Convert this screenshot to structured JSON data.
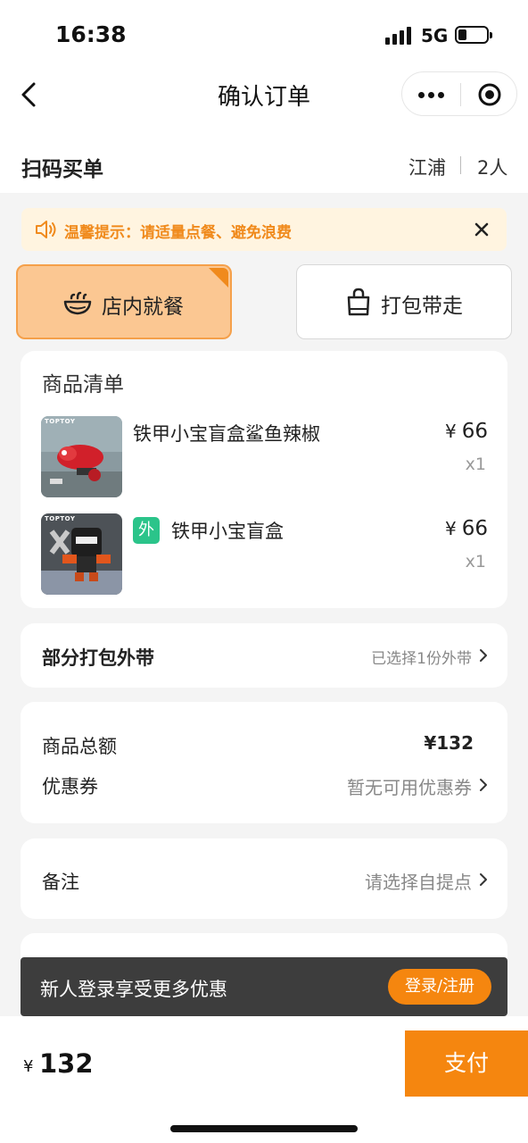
{
  "status_bar": {
    "time": "16:38",
    "network": "5G",
    "battery_level": 0.3
  },
  "nav": {
    "title": "确认订单"
  },
  "header": {
    "subtitle": "扫码买单",
    "store": "江浦",
    "people": "2人"
  },
  "notice": {
    "text": "温馨提示：请适量点餐、避免浪费"
  },
  "dining_modes": [
    {
      "label": "店内就餐",
      "selected": true,
      "icon": "bowl-icon"
    },
    {
      "label": "打包带走",
      "selected": false,
      "icon": "bag-icon"
    }
  ],
  "goods": {
    "title": "商品清单",
    "currency": "¥",
    "items": [
      {
        "name": "铁甲小宝盲盒鲨鱼辣椒",
        "price": "66",
        "qty": "x1",
        "brand": "TOPTOY",
        "badge": ""
      },
      {
        "name": "铁甲小宝盲盒",
        "price": "66",
        "qty": "x1",
        "brand": "TOPTOY",
        "badge": "外"
      }
    ]
  },
  "packing": {
    "label": "部分打包外带",
    "value": "已选择1份外带"
  },
  "summary": {
    "total_label": "商品总额",
    "total_value": "¥132",
    "coupon_label": "优惠券",
    "coupon_value": "暂无可用优惠券"
  },
  "remark": {
    "label": "备注",
    "value": "请选择自提点"
  },
  "login_promo": {
    "text": "新人登录享受更多优惠",
    "button": "登录/注册"
  },
  "bottom": {
    "currency": "¥",
    "amount": "132",
    "pay_label": "支付"
  },
  "colors": {
    "accent": "#f5860f",
    "selected_bg": "#fbc792",
    "notice_bg": "#fff4e0",
    "badge_green": "#2bc48a"
  }
}
